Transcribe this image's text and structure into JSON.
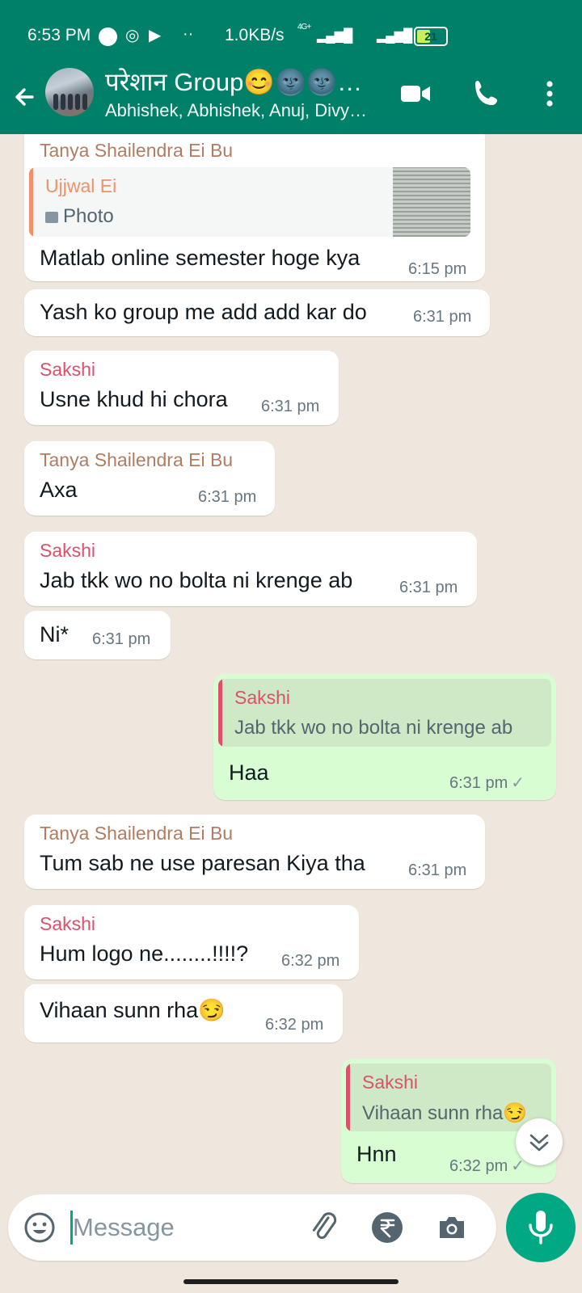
{
  "status_bar": {
    "time": "6:53 PM",
    "net_speed": "1.0KB/s",
    "network": "4G+",
    "battery": "21"
  },
  "header": {
    "title": "परेशान Group😊🌚🌚…",
    "subtitle": "Abhishek, Abhishek, Anuj, Divy…"
  },
  "messages": [
    {
      "sender": "Tanya Shailendra Ei Bu",
      "reply_to": {
        "name": "Ujjwal Ei",
        "text": "Photo"
      },
      "text": "Matlab online semester hoge kya",
      "time": "6:15 pm"
    },
    {
      "text": "Yash ko group me add add kar do",
      "time": "6:31 pm"
    },
    {
      "sender": "Sakshi",
      "text": "Usne khud hi chora",
      "time": "6:31 pm"
    },
    {
      "sender": "Tanya Shailendra Ei Bu",
      "text": "Axa",
      "time": "6:31 pm"
    },
    {
      "sender": "Sakshi",
      "text": "Jab tkk wo no bolta ni krenge ab",
      "time": "6:31 pm"
    },
    {
      "text": "Ni*",
      "time": "6:31 pm"
    },
    {
      "outgoing": true,
      "reply_to": {
        "name": "Sakshi",
        "text": "Jab tkk wo no bolta ni krenge ab"
      },
      "text": "Haa",
      "time": "6:31 pm"
    },
    {
      "sender": "Tanya Shailendra Ei Bu",
      "text": "Tum sab ne use paresan Kiya tha",
      "time": "6:31 pm"
    },
    {
      "sender": "Sakshi",
      "text": "Hum logo ne........!!!!?",
      "time": "6:32 pm"
    },
    {
      "text": "Vihaan sunn rha😏",
      "time": "6:32 pm"
    },
    {
      "outgoing": true,
      "reply_to": {
        "name": "Sakshi",
        "text": "Vihaan sunn rha😏"
      },
      "text": "Hnn",
      "time": "6:32 pm"
    }
  ],
  "composer": {
    "placeholder": "Message"
  },
  "colors": {
    "header": "#008069",
    "accent": "#00a884",
    "outgoing_bubble": "#d9fdd3",
    "chat_background": "#efe7de"
  },
  "icons": [
    "back-arrow-icon",
    "video-call-icon",
    "voice-call-icon",
    "more-options-icon",
    "emoji-icon",
    "attach-icon",
    "rupee-payment-icon",
    "camera-icon",
    "mic-icon",
    "scroll-down-icon",
    "photo-icon"
  ]
}
